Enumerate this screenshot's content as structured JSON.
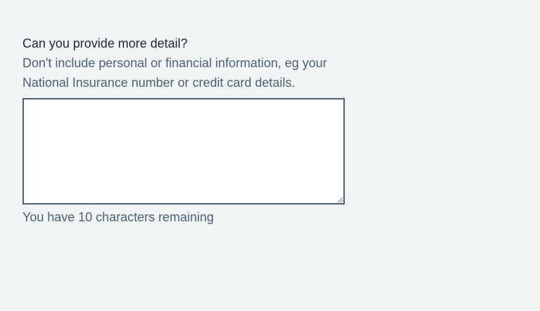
{
  "feedback_form": {
    "label": "Can you provide more detail?",
    "hint": "Don't include personal or financial information, eg your National Insurance number or credit card details.",
    "textarea": {
      "value": "",
      "placeholder": ""
    },
    "character_count": {
      "message": "You have 10 characters remaining"
    }
  },
  "colors": {
    "page_background": "#f0f4f5",
    "text": "#212b32",
    "secondary_text": "#4c6272",
    "input_border": "#4c6272",
    "input_background": "#ffffff"
  }
}
